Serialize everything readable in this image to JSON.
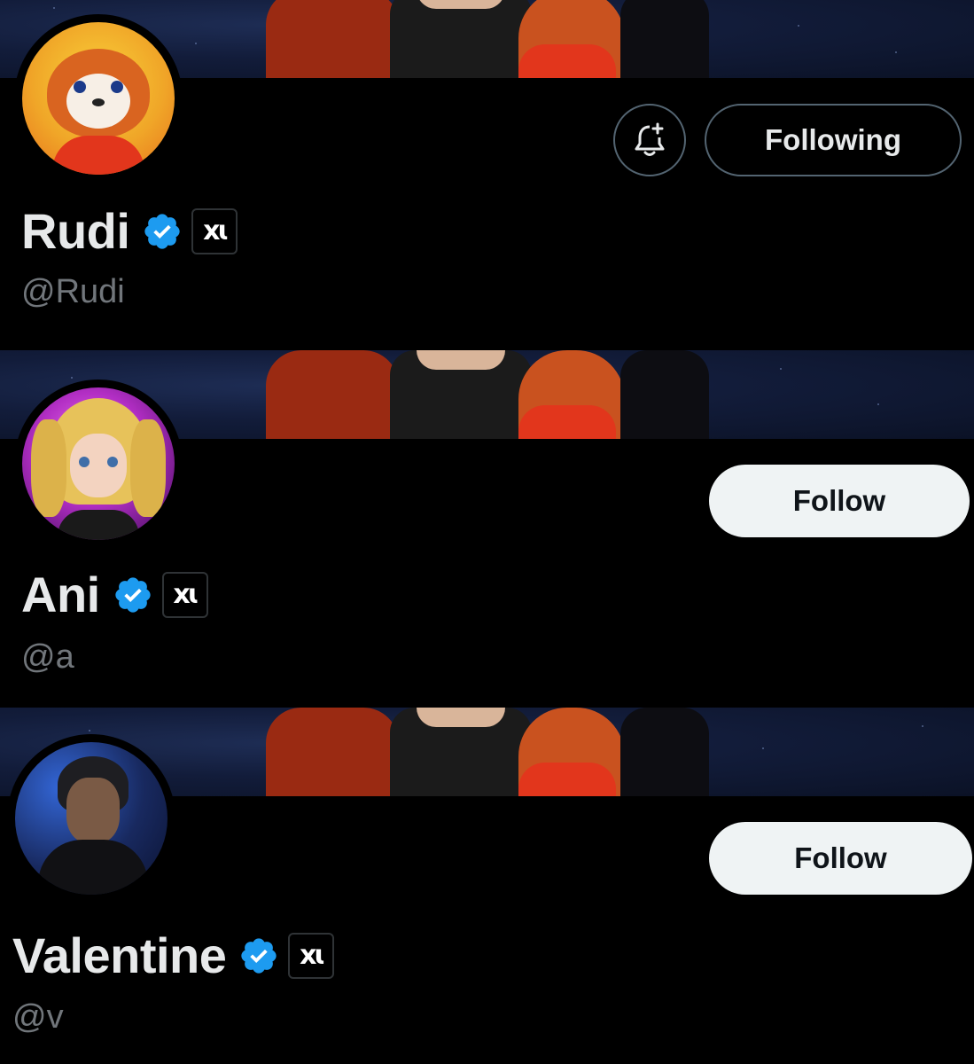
{
  "profiles": [
    {
      "name": "Rudi",
      "handle": "@Rudi",
      "follow_state": "Following",
      "verified": true,
      "badge": "xɩ",
      "avatar": "red-panda-avatar",
      "notifications_icon": "bell-plus-icon"
    },
    {
      "name": "Ani",
      "handle": "@a",
      "follow_state": "Follow",
      "verified": true,
      "badge": "xɩ",
      "avatar": "anime-girl-avatar"
    },
    {
      "name": "Valentine",
      "handle": "@v",
      "follow_state": "Follow",
      "verified": true,
      "badge": "xɩ",
      "avatar": "dark-haired-man-avatar"
    }
  ],
  "colors": {
    "background": "#000000",
    "text": "#e7e9ea",
    "secondary_text": "#71767b",
    "verified_blue": "#1d9bf0",
    "follow_button": "#eff3f4"
  }
}
